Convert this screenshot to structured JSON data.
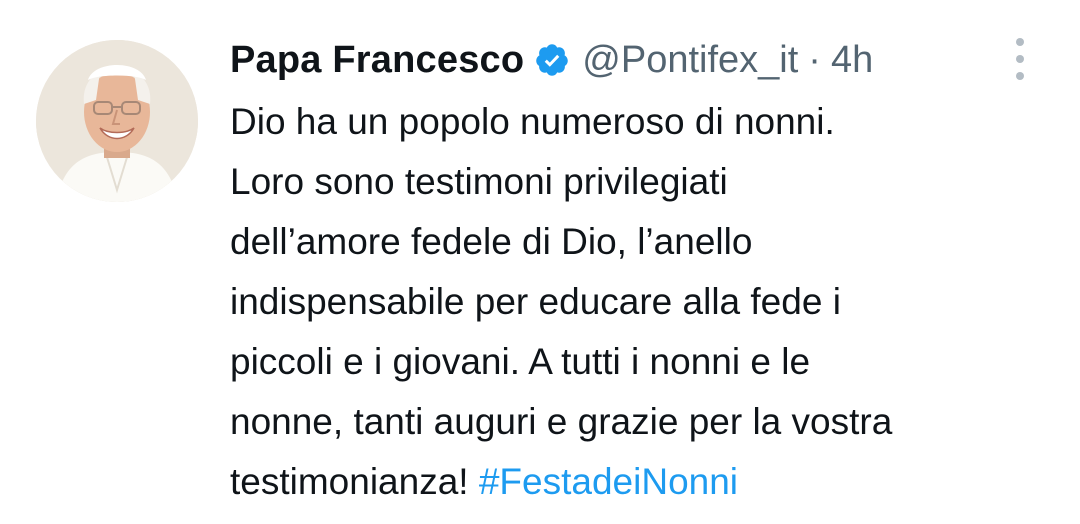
{
  "tweet": {
    "author": {
      "display_name": "Papa Francesco",
      "handle": "@Pontifex_it",
      "verified": true,
      "avatar": "avatar-photo"
    },
    "separator": "·",
    "timestamp": "4h",
    "more_icon": "more-vertical-icon",
    "verified_icon": "verified-badge-icon",
    "text_lines": [
      "Dio ha un popolo numeroso di nonni.",
      "Loro sono testimoni privilegiati",
      "dell’amore fedele di Dio, l’anello",
      "indispensabile per educare alla fede i",
      "piccoli e i giovani. A tutti i nonni e le",
      "nonne, tanti auguri e grazie per la vostra"
    ],
    "last_line_text": "testimonianza! ",
    "hashtag": "#FestadeiNonni"
  },
  "colors": {
    "text": "#0f1419",
    "secondary": "#536471",
    "link": "#1d9bf0",
    "verified": "#1d9bf0"
  }
}
